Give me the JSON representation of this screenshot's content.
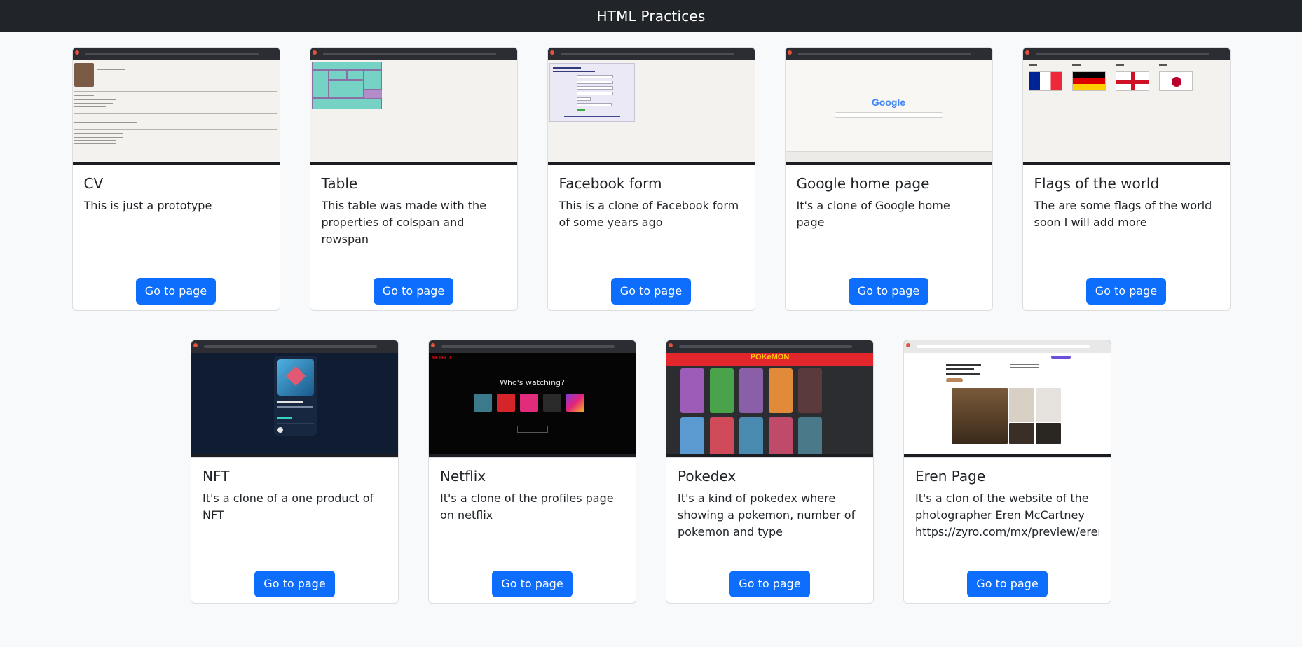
{
  "navbar": {
    "title": "HTML Practices"
  },
  "cards": [
    {
      "title": "CV",
      "text": "This is just a prototype",
      "button": "Go to page"
    },
    {
      "title": "Table",
      "text": "This table was made with the properties of colspan and rowspan",
      "button": "Go to page"
    },
    {
      "title": "Facebook form",
      "text": "This is a clone of Facebook form of some years ago",
      "button": "Go to page"
    },
    {
      "title": "Google home page",
      "text": "It's a clone of Google home page",
      "button": "Go to page"
    },
    {
      "title": "Flags of the world",
      "text": "The are some flags of the world soon I will add more",
      "button": "Go to page"
    },
    {
      "title": "NFT",
      "text": "It's a clone of a one product of NFT",
      "button": "Go to page"
    },
    {
      "title": "Netflix",
      "text": "It's a clone of the profiles page on netflix",
      "button": "Go to page"
    },
    {
      "title": "Pokedex",
      "text": "It's a kind of pokedex where showing a pokemon, number of pokemon and type",
      "button": "Go to page"
    },
    {
      "title": "Eren Page",
      "text": "It's a clon of the website of the photographer Eren McCartney https://zyro.com/mx/preview/eren",
      "button": "Go to page"
    }
  ],
  "thumbnails": {
    "google_logo": "Google",
    "netflix_heading": "Who's watching?",
    "netflix_logo": "NETFLIX",
    "pokedex_logo": "POKéMON"
  },
  "colors": {
    "navbar_bg": "#212529",
    "page_bg": "#f8f9fa",
    "button_bg": "#0d6efd"
  }
}
